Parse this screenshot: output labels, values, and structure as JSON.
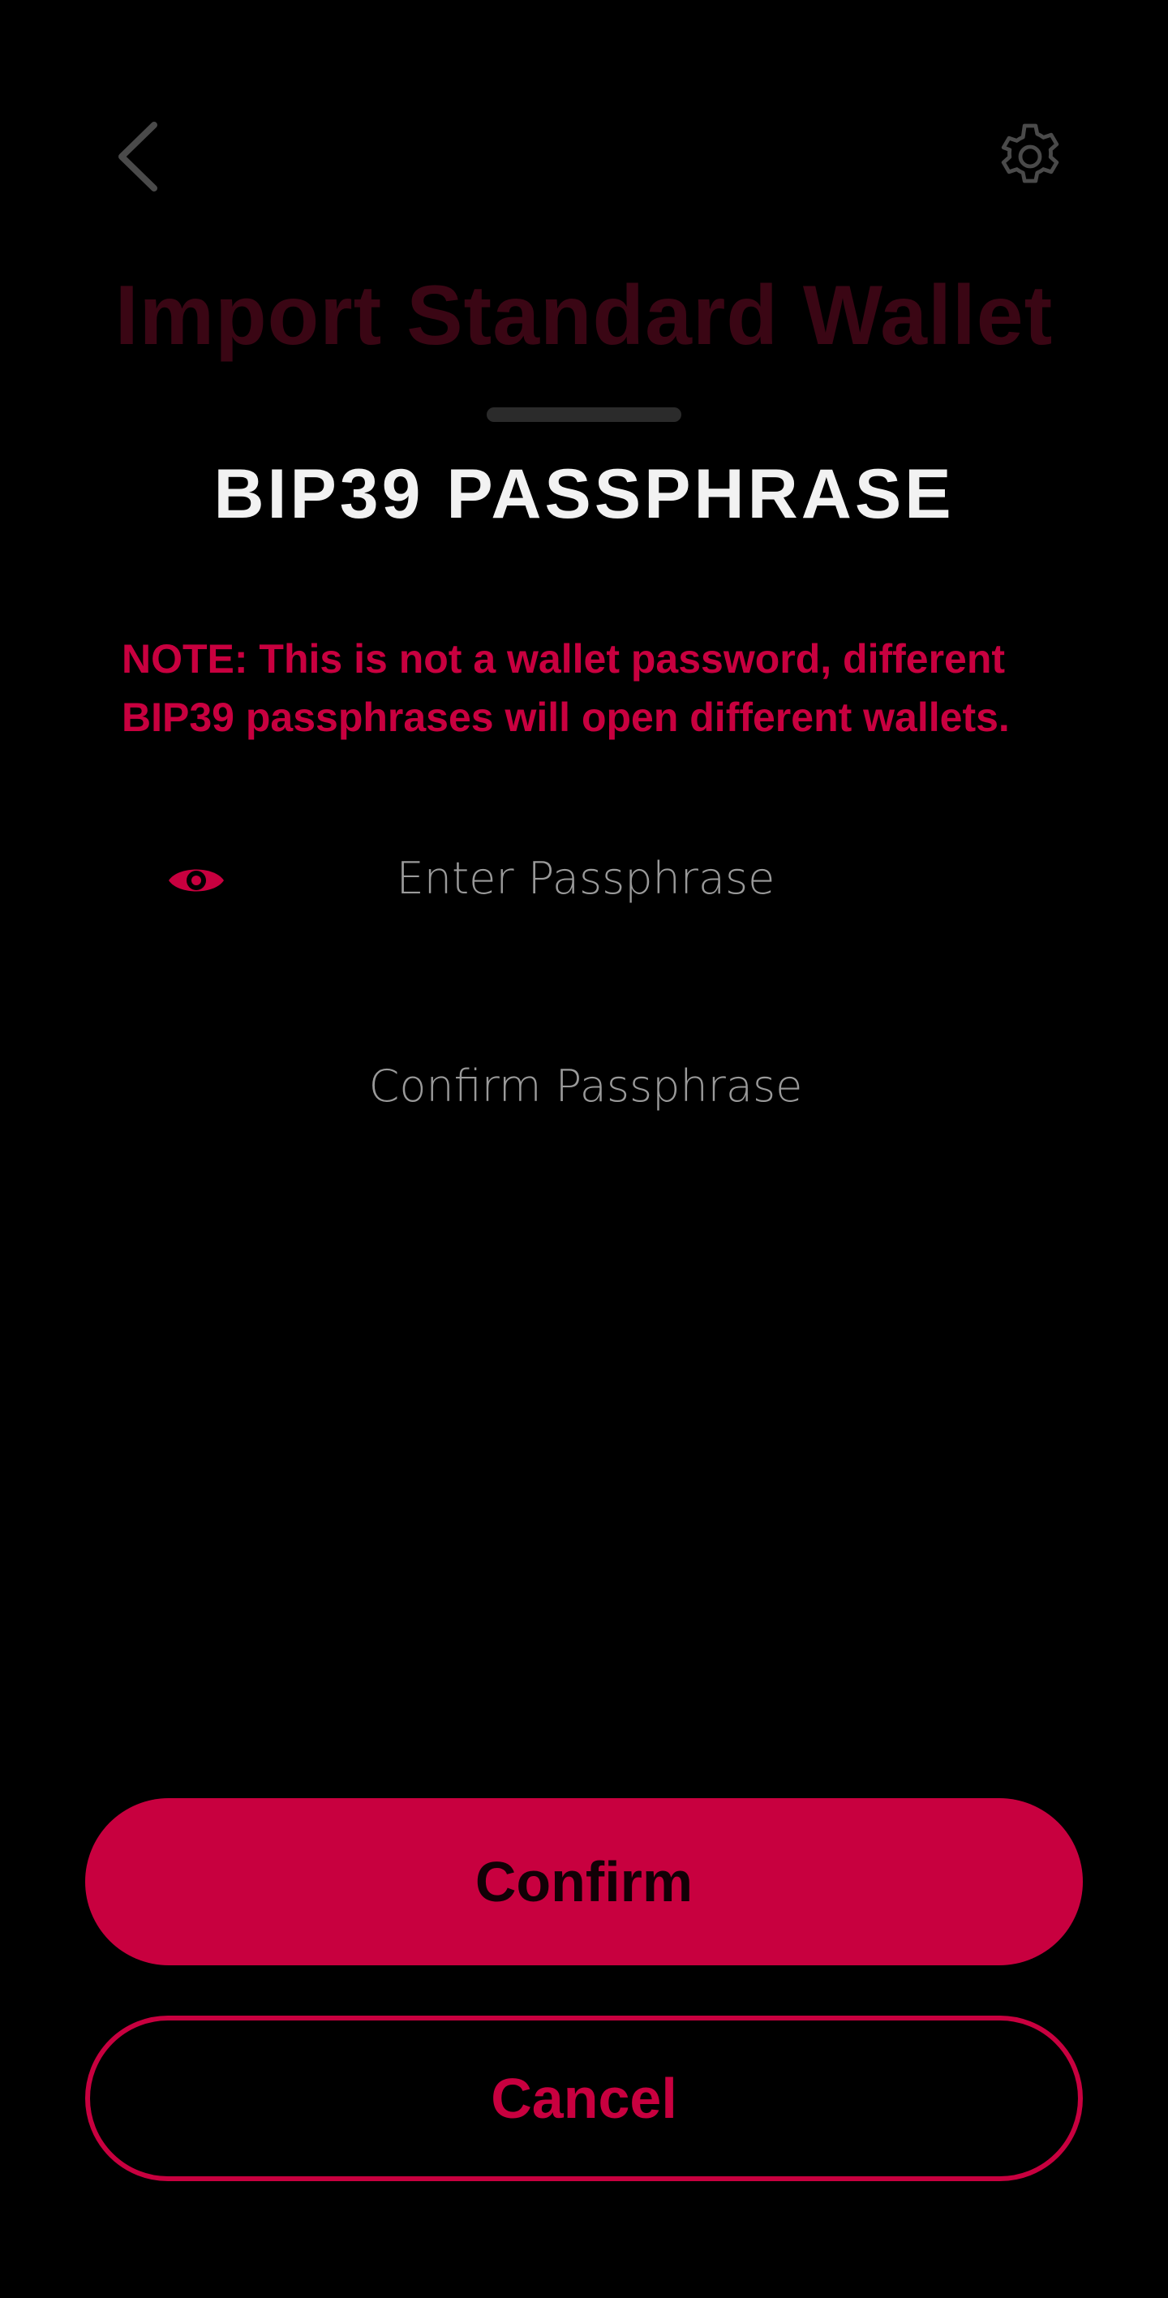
{
  "header": {
    "back_icon": "chevron-left-icon",
    "settings_icon": "gear-icon",
    "background_title": "Import Standard Wallet"
  },
  "sheet": {
    "title": "BIP39 PASSPHRASE",
    "note": "NOTE: This is not a wallet password, different BIP39 passphrases will open different wallets.",
    "visibility_icon": "eye-icon",
    "passphrase": {
      "value": "",
      "placeholder": "Enter Passphrase"
    },
    "confirm_passphrase": {
      "value": "",
      "placeholder": "Confirm Passphrase"
    },
    "confirm_label": "Confirm",
    "cancel_label": "Cancel"
  },
  "colors": {
    "accent": "#c8003f",
    "background": "#000000",
    "icon": "#4a4a4a"
  }
}
